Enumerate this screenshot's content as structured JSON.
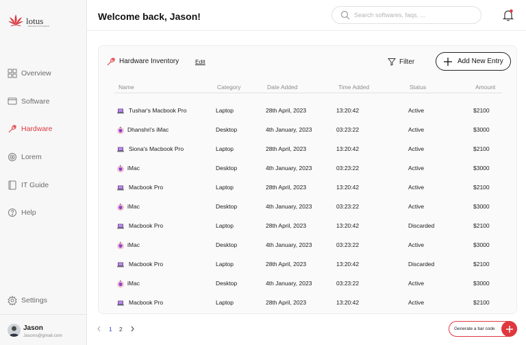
{
  "brand": {
    "name": "lotus",
    "tagline": "Business & Innovations",
    "accent": "#e0383e"
  },
  "sidebar": {
    "items": [
      {
        "label": "Overview",
        "icon": "grid-icon"
      },
      {
        "label": "Software",
        "icon": "monitor-icon"
      },
      {
        "label": "Hardware",
        "icon": "wrench-icon",
        "active": true
      },
      {
        "label": "Lorem",
        "icon": "target-icon"
      },
      {
        "label": "IT Guide",
        "icon": "book-icon"
      },
      {
        "label": "Help",
        "icon": "help-circle-icon"
      }
    ],
    "settings": {
      "label": "Settings",
      "icon": "gear-icon"
    },
    "user": {
      "name": "Jason",
      "email": "Jasons@gmail.com"
    }
  },
  "header": {
    "welcome": "Welcome back, Jason!",
    "search_placeholder": "Search softwares, faqs, ..."
  },
  "inventory": {
    "title": "Hardware Inventory",
    "edit_label": "Edit",
    "filter_label": "Filter",
    "add_label": "Add New Entry",
    "columns": [
      "Name",
      "Category",
      "Date Added",
      "Time Added",
      "Status",
      "Amount"
    ],
    "rows": [
      {
        "name": "Tushar's Macbook Pro",
        "category": "Laptop",
        "date": "28th April, 2023",
        "time": "13:20:42",
        "status": "Active",
        "amount": "$2100",
        "icon": "laptop-icon"
      },
      {
        "name": "Dhanshri's iMac",
        "category": "Desktop",
        "date": "4th January, 2023",
        "time": "03:23:22",
        "status": "Active",
        "amount": "$3000",
        "icon": "apple-icon"
      },
      {
        "name": "Siona's Macbook Pro",
        "category": "Laptop",
        "date": "28th April, 2023",
        "time": "13:20:42",
        "status": "Active",
        "amount": "$2100",
        "icon": "laptop-icon"
      },
      {
        "name": "iMac",
        "category": "Desktop",
        "date": "4th January, 2023",
        "time": "03:23:22",
        "status": "Active",
        "amount": "$3000",
        "icon": "apple-icon"
      },
      {
        "name": "Macbook Pro",
        "category": "Laptop",
        "date": "28th April, 2023",
        "time": "13:20:42",
        "status": "Active",
        "amount": "$2100",
        "icon": "laptop-icon"
      },
      {
        "name": "iMac",
        "category": "Desktop",
        "date": "4th January, 2023",
        "time": "03:23:22",
        "status": "Active",
        "amount": "$3000",
        "icon": "apple-icon"
      },
      {
        "name": "Macbook Pro",
        "category": "Laptop",
        "date": "28th April, 2023",
        "time": "13:20:42",
        "status": "Discarded",
        "amount": "$2100",
        "icon": "laptop-icon"
      },
      {
        "name": "iMac",
        "category": "Desktop",
        "date": "4th January, 2023",
        "time": "03:23:22",
        "status": "Active",
        "amount": "$3000",
        "icon": "apple-icon"
      },
      {
        "name": "Macbook Pro",
        "category": "Laptop",
        "date": "28th April, 2023",
        "time": "13:20:42",
        "status": "Discarded",
        "amount": "$2100",
        "icon": "laptop-icon"
      },
      {
        "name": "iMac",
        "category": "Desktop",
        "date": "4th January, 2023",
        "time": "03:23:22",
        "status": "Active",
        "amount": "$3000",
        "icon": "apple-icon"
      },
      {
        "name": "Macbook Pro",
        "category": "Laptop",
        "date": "28th April, 2023",
        "time": "13:20:42",
        "status": "Active",
        "amount": "$2100",
        "icon": "laptop-icon"
      }
    ]
  },
  "pagination": {
    "pages": [
      "1",
      "2"
    ],
    "current": "1"
  },
  "barcode": {
    "label": "Generate a bar code"
  }
}
